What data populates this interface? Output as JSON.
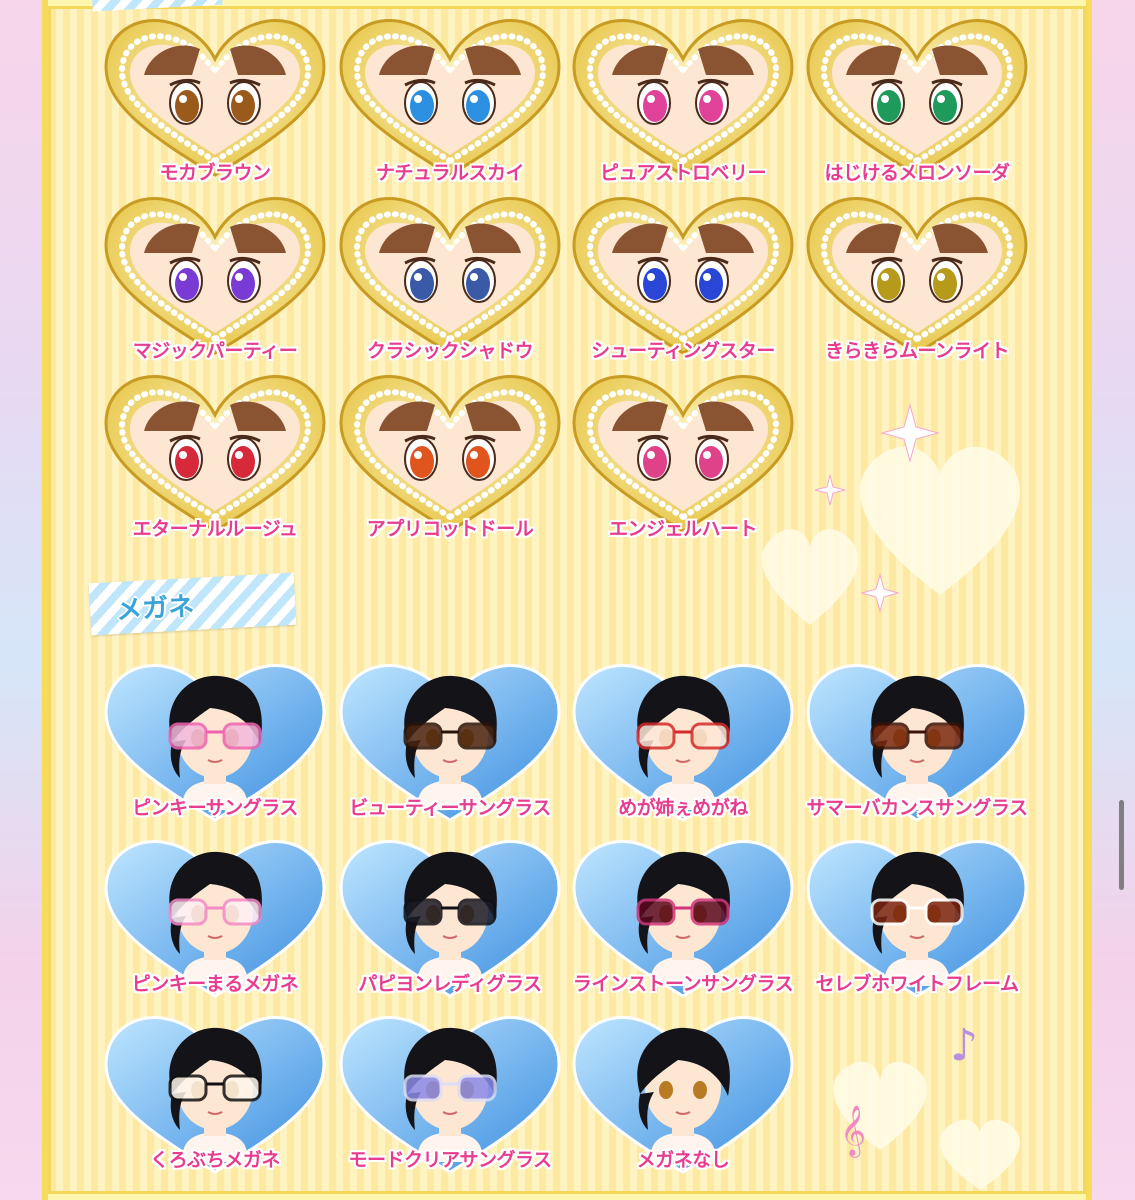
{
  "section_heading": "メガネ",
  "colors": {
    "label": "#e83c8e",
    "gold": "#e5c23e",
    "accent_blue": "#3aa3d9"
  },
  "eye_colors": [
    {
      "label": "モカブラウン",
      "iris": "#9a5a1c"
    },
    {
      "label": "ナチュラルスカイ",
      "iris": "#2c8fe0"
    },
    {
      "label": "ピュアストロベリー",
      "iris": "#e0429a"
    },
    {
      "label": "はじけるメロンソーダ",
      "iris": "#1e9a5a"
    },
    {
      "label": "マジックパーティー",
      "iris": "#7a3ad6"
    },
    {
      "label": "クラシックシャドウ",
      "iris": "#3a5aa8"
    },
    {
      "label": "シューティングスター",
      "iris": "#2a46d6"
    },
    {
      "label": "きらきらムーンライト",
      "iris": "#b89a1a"
    },
    {
      "label": "エターナルルージュ",
      "iris": "#d62a3a"
    },
    {
      "label": "アプリコットドール",
      "iris": "#e0541e"
    },
    {
      "label": "エンジェルハート",
      "iris": "#e0428a"
    }
  ],
  "glasses": [
    {
      "label": "ピンキーサングラス",
      "icon": "pink-sunglasses-icon",
      "lens": "#f3b9dc",
      "frame": "#f062b0"
    },
    {
      "label": "ビューティーサングラス",
      "icon": "brown-sunglasses-icon",
      "lens": "#4a2410",
      "frame": "#2a1408"
    },
    {
      "label": "めが姉ぇめがね",
      "icon": "red-glasses-icon",
      "lens": "#ffe8d8",
      "frame": "#d62a2a"
    },
    {
      "label": "サマーバカンスサングラス",
      "icon": "vacation-sunglasses-icon",
      "lens": "#7a2a10",
      "frame": "#3a1206"
    },
    {
      "label": "ピンキーまるメガネ",
      "icon": "round-pink-glasses-icon",
      "lens": "#fff0f6",
      "frame": "#f48ac6"
    },
    {
      "label": "パピヨンレディグラス",
      "icon": "butterfly-glasses-icon",
      "lens": "#1a1a26",
      "frame": "#101018"
    },
    {
      "label": "ラインストーンサングラス",
      "icon": "rhinestone-sunglasses-icon",
      "lens": "#5a0a1e",
      "frame": "#d0357a"
    },
    {
      "label": "セレブホワイトフレーム",
      "icon": "white-frame-glasses-icon",
      "lens": "#7a2410",
      "frame": "#ffffff"
    },
    {
      "label": "くろぶちメガネ",
      "icon": "black-frame-glasses-icon",
      "lens": "#fff6ea",
      "frame": "#111111"
    },
    {
      "label": "モードクリアサングラス",
      "icon": "clear-sunglasses-icon",
      "lens": "#8a8ae8",
      "frame": "#dcdcf6"
    },
    {
      "label": "メガネなし",
      "icon": "no-glasses-icon",
      "lens": "",
      "frame": ""
    }
  ]
}
